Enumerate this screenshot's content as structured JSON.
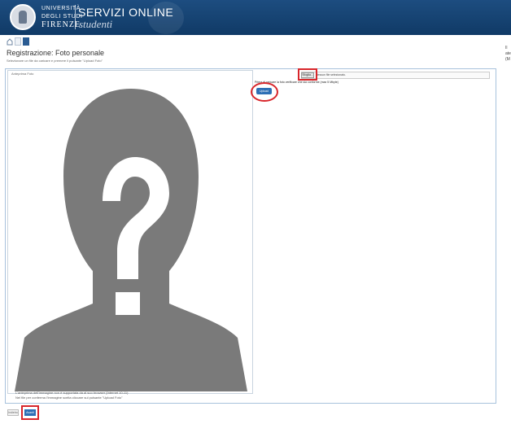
{
  "header": {
    "university_line1": "UNIVERSITÀ",
    "university_line2": "DEGLI STUDI",
    "university_line3": "FIRENZE",
    "service_title": "SERVIZI ONLINE",
    "service_subtitle": "studenti",
    "colors": {
      "band": "#1d4d80",
      "text": "#ffffff"
    }
  },
  "toolbar": {
    "icons": [
      "home-icon",
      "document-icon",
      "menu-icon"
    ]
  },
  "side_panel": {
    "line1": "Il",
    "line2": "ate",
    "line3": "(M"
  },
  "page": {
    "title": "Registrazione: Foto personale",
    "hint": "Selezionare un file da caricare e premere il pulsante \"Upload Foto\""
  },
  "photo_frame": {
    "tag": "Anteprima Foto",
    "placeholder_icon": "question-mark-silhouette",
    "placeholder_colors": {
      "silhouette": "#7a7a7a",
      "mark": "#ffffff"
    },
    "caption_line1": "L'anteprima dell'immagine non è supportata da al suo browser (Internet 10-11)",
    "caption_line2": "Nel file per conferma l'immagine scelta cliccare sul pulsante \"Upload Foto\""
  },
  "upload": {
    "browse_label": "Sfoglia...",
    "file_status": "Nessun file selezionato.",
    "instructions": "Prima di caricare la foto verificare che sia conforme (max 5 Mbyte)",
    "upload_button_label": "Upload Foto"
  },
  "footer": {
    "back_label": "Indietro",
    "next_label": "Avanti"
  },
  "annotations": {
    "highlight_color": "#d8262b"
  }
}
